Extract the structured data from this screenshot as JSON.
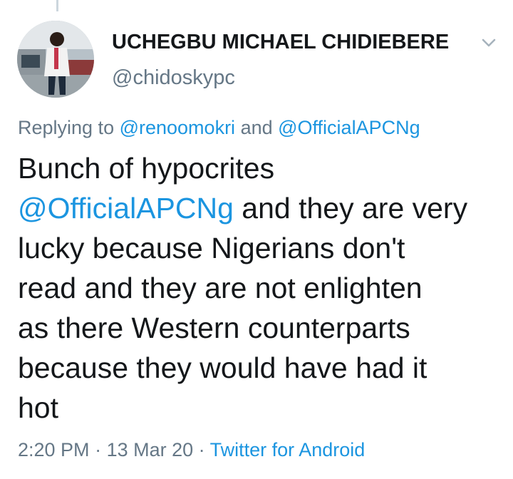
{
  "author": {
    "display_name": "UCHEGBU MICHAEL CHIDIEBERE",
    "handle": "@chidoskypc"
  },
  "reply_context": {
    "prefix": "Replying to ",
    "mention_1": "@renoomokri",
    "joiner": " and ",
    "mention_2": "@OfficialAPCNg"
  },
  "tweet": {
    "line1": "Bunch of hypocrites",
    "line2_mention": "@OfficialAPCNg",
    "line2_rest": " and they are very",
    "line3": "lucky because Nigerians don't",
    "line4": "read and they are not enlighten",
    "line5": "as there Western counterparts",
    "line6": "because they would have had it",
    "line7": "hot"
  },
  "meta": {
    "time": "2:20 PM",
    "sep1": " · ",
    "date": "13 Mar 20",
    "sep2": " · ",
    "source": "Twitter for Android"
  },
  "colors": {
    "link": "#1b95e0",
    "secondary_text": "#657786",
    "primary_text": "#14171a"
  },
  "icons": {
    "menu": "chevron-down-icon",
    "avatar": "profile-photo"
  }
}
